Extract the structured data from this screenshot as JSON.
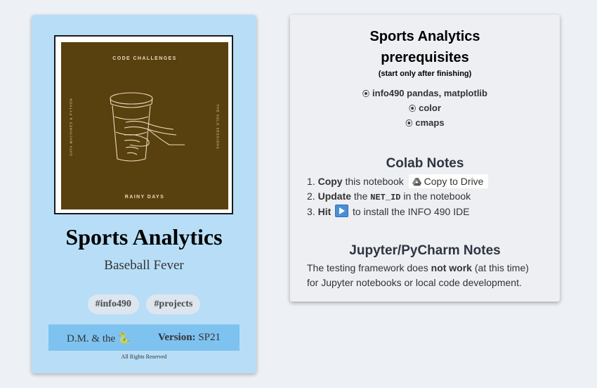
{
  "card": {
    "cover": {
      "top_text": "CODE CHALLENGES",
      "bottom_text": "RAINY DAYS",
      "left_text": "DATA MACHINES & PYTHON",
      "right_text": "THE SOLO SESSIONS"
    },
    "title": "Sports Analytics",
    "subtitle": "Baseball Fever",
    "tags": [
      "#info490",
      "#projects"
    ],
    "author": "D.M. & the 🐍",
    "version_label": "Version:",
    "version_value": "SP21",
    "rights": "All Rights Reserved"
  },
  "panel": {
    "title_line1": "Sports Analytics",
    "title_line2": "prerequisites",
    "subtitle": "(start only after finishing)",
    "prereqs": [
      "info490 pandas, matplotlib",
      "color",
      "cmaps"
    ],
    "bullet": "⦿",
    "colab": {
      "heading": "Colab Notes",
      "step1_num": "1.",
      "step1_bold": "Copy",
      "step1_text": "this notebook",
      "drive_button": "Copy to Drive",
      "step2_num": "2.",
      "step2_bold": "Update",
      "step2_text_a": "the",
      "step2_code": "NET_ID",
      "step2_text_b": "in the notebook",
      "step3_num": "3.",
      "step3_bold": "Hit",
      "step3_text": "to install the INFO 490 IDE"
    },
    "jupyter": {
      "heading": "Jupyter/PyCharm Notes",
      "line1_a": "The testing framework does",
      "line1_bold": "not work",
      "line1_b": "(at this time)",
      "line2": "for Jupyter notebooks or local code development."
    }
  },
  "colors": {
    "card_bg": "#b8def7",
    "cover_bg": "#58400f",
    "footer_bar": "#7ec2f0",
    "page_bg": "#edf1f6"
  }
}
